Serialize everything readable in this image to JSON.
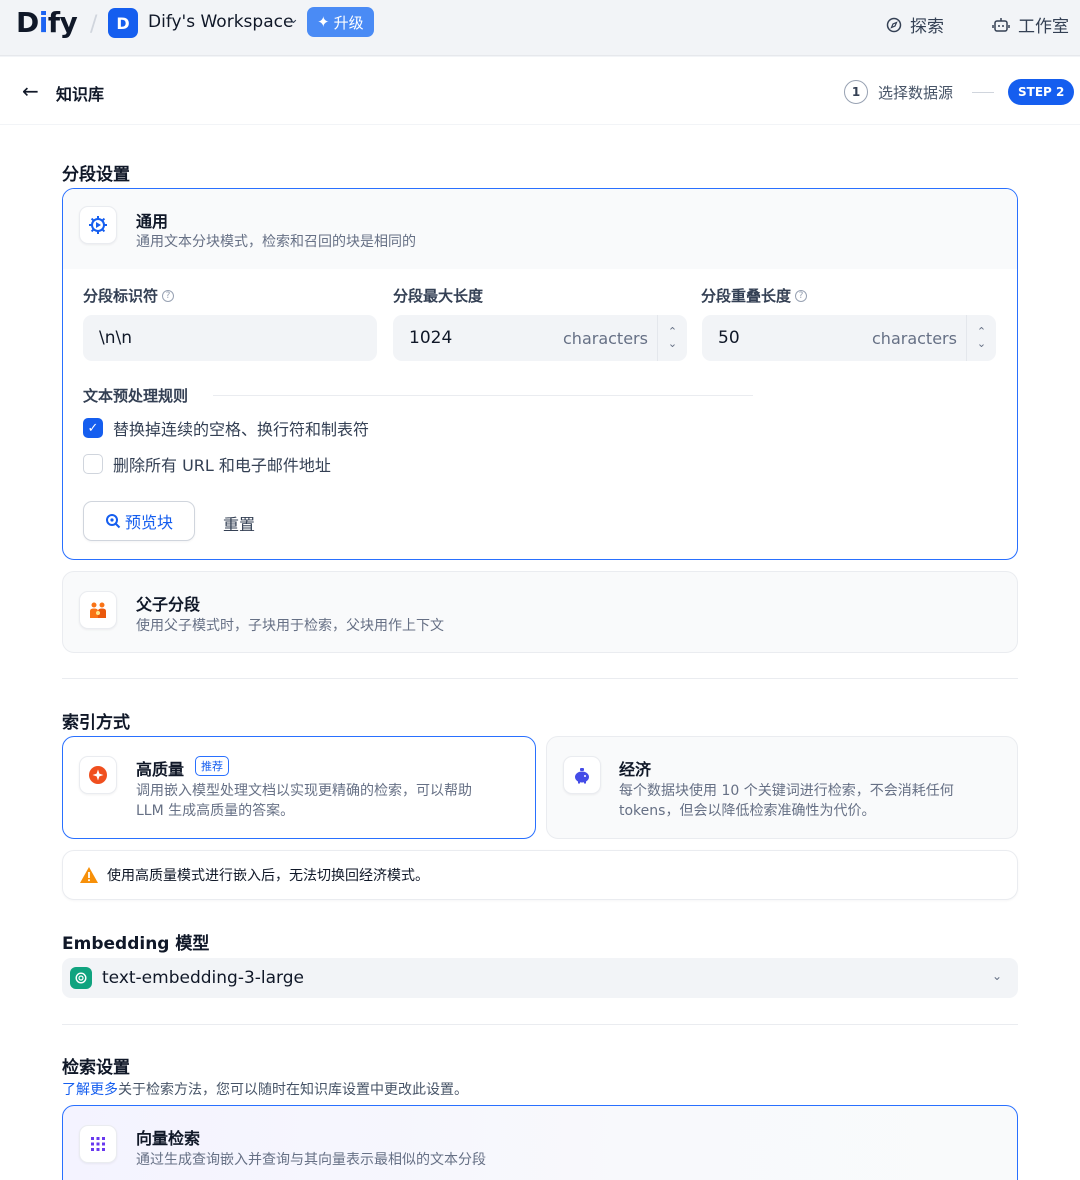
{
  "topbar": {
    "logo_prefix": "D",
    "logo_i": "i",
    "logo_suffix": "fy",
    "workspace_initial": "D",
    "workspace_name": "Dify's Workspace",
    "upgrade_label": "升级",
    "explore_label": "探索",
    "studio_label": "工作室"
  },
  "header": {
    "title": "知识库",
    "step1_number": "1",
    "step1_label": "选择数据源",
    "step2_label": "STEP 2"
  },
  "chunk_settings": {
    "section_title": "分段设置",
    "general": {
      "title": "通用",
      "desc": "通用文本分块模式，检索和召回的块是相同的",
      "delimiter_label": "分段标识符",
      "delimiter_value": "\\n\\n",
      "max_length_label": "分段最大长度",
      "max_length_value": "1024",
      "overlap_label": "分段重叠长度",
      "overlap_value": "50",
      "unit": "characters",
      "rules_title": "文本预处理规则",
      "rule1": "替换掉连续的空格、换行符和制表符",
      "rule1_checked": true,
      "rule2": "删除所有 URL 和电子邮件地址",
      "rule2_checked": false,
      "preview_label": "预览块",
      "reset_label": "重置"
    },
    "parent_child": {
      "title": "父子分段",
      "desc": "使用父子模式时，子块用于检索，父块用作上下文"
    }
  },
  "index_method": {
    "section_title": "索引方式",
    "high_quality": {
      "title": "高质量",
      "badge": "推荐",
      "desc_line1": "调用嵌入模型处理文档以实现更精确的检索，可以帮助",
      "desc_line2": "LLM 生成高质量的答案。"
    },
    "economy": {
      "title": "经济",
      "desc_line1": "每个数据块使用 10 个关键词进行检索，不会消耗任何",
      "desc_line2": "tokens，但会以降低检索准确性为代价。"
    },
    "warning": "使用高质量模式进行嵌入后，无法切换回经济模式。"
  },
  "embedding": {
    "section_title": "Embedding 模型",
    "model_name": "text-embedding-3-large"
  },
  "retrieval": {
    "section_title": "检索设置",
    "learn_more": "了解更多",
    "subtitle_rest": "关于检索方法，您可以随时在知识库设置中更改此设置。",
    "vector": {
      "title": "向量检索",
      "desc": "通过生成查询嵌入并查询与其向量表示最相似的文本分段"
    }
  },
  "colors": {
    "primary": "#155eef",
    "border_active": "#2970ff",
    "warning": "#f79009",
    "openai": "#10a37f",
    "hq_icon": "#f04f1e",
    "eco_icon": "#444ce7",
    "vector_icon": "#6938ef"
  }
}
